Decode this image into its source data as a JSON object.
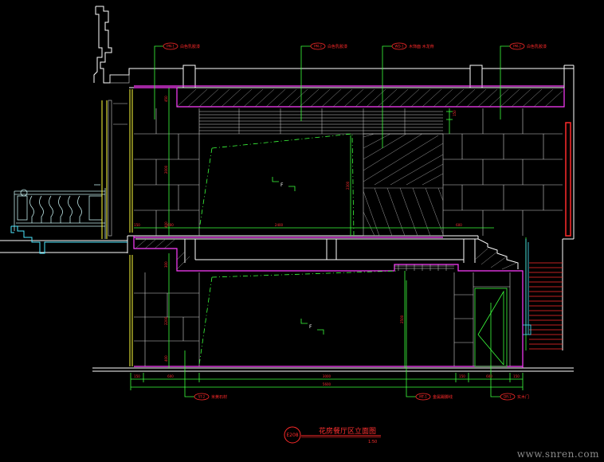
{
  "drawing": {
    "title": "花房餐厅区立面图",
    "scale": "1:50",
    "view_mark": "E208"
  },
  "callouts_top": [
    {
      "num": "PM-1",
      "label": "白色乳胶漆"
    },
    {
      "num": "PM-2",
      "label": "白色乳胶漆"
    },
    {
      "num": "WD-1",
      "label": "木饰面 木龙骨"
    },
    {
      "num": "PM-2",
      "label": "白色乳胶漆"
    }
  ],
  "callouts_bottom": [
    {
      "num": "ST-2",
      "label": "米黄石材"
    },
    {
      "num": "MT-1",
      "label": "金属踢脚线"
    },
    {
      "num": "DR-1",
      "label": "实木门"
    }
  ],
  "dimensions": {
    "bottom_row": [
      "150",
      "600",
      "3000",
      "150",
      "600",
      "150"
    ],
    "bottom_total": "5600",
    "upper_row": [
      "150",
      "600",
      "2400",
      "600"
    ],
    "vertical_upper": [
      "450",
      "2000",
      "400"
    ],
    "vertical_lower": [
      "300",
      "2200",
      "400"
    ],
    "section_vertical": [
      "2300",
      "2500"
    ],
    "small_top": "150"
  },
  "marks": [
    "F",
    "F"
  ],
  "watermark": "www.snren.com"
}
